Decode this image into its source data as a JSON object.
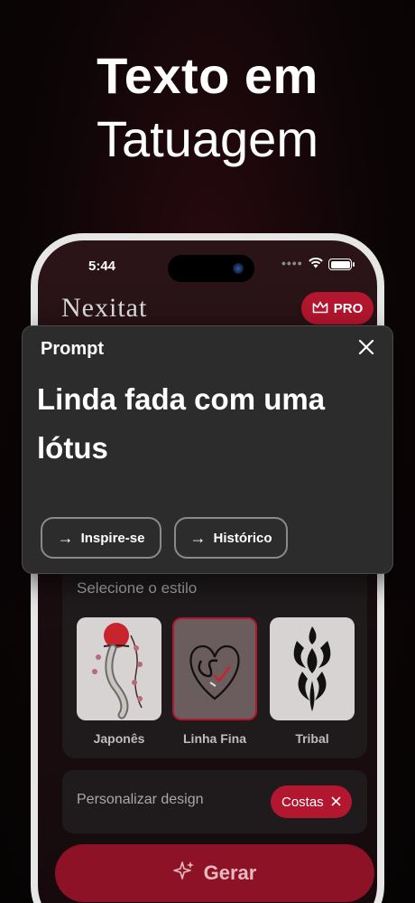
{
  "headline": {
    "line1": "Texto em",
    "line2": "Tatuagem"
  },
  "statusbar": {
    "time": "5:44",
    "signal_dots": "••••",
    "wifi_icon": "wifi-icon",
    "battery_icon": "battery-icon"
  },
  "app": {
    "logo": "Nexitat",
    "pro_label": "PRO",
    "accent": "#b3162f"
  },
  "prompt": {
    "title": "Prompt",
    "text": "Linda fada com uma lótus",
    "inspire_label": "Inspire-se",
    "history_label": "Histórico"
  },
  "style_section": {
    "title": "Selecione o estilo",
    "items": [
      {
        "label": "Japonês",
        "selected": false
      },
      {
        "label": "Linha Fina",
        "selected": true
      },
      {
        "label": "Tribal",
        "selected": false
      }
    ]
  },
  "customize": {
    "label": "Personalizar design",
    "tag": "Costas"
  },
  "generate": {
    "label": "Gerar"
  }
}
